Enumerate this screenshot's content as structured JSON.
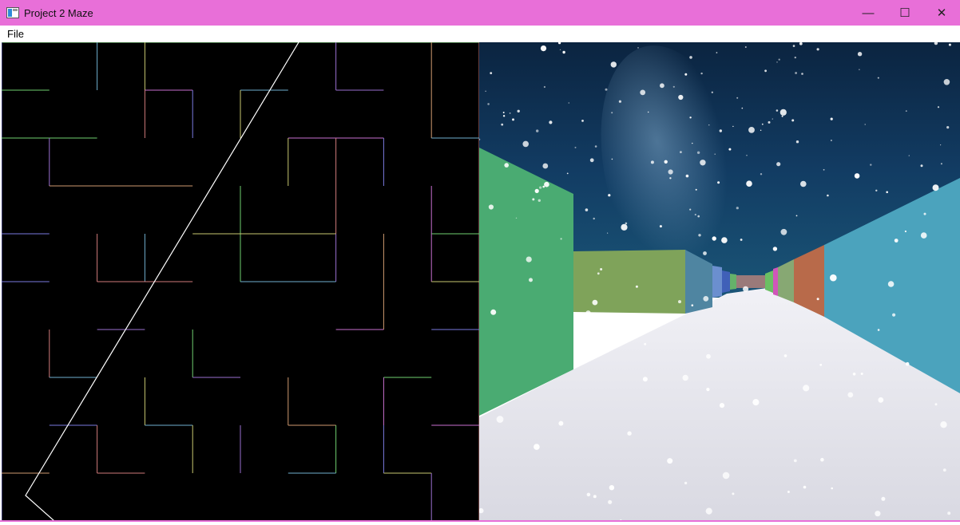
{
  "window": {
    "title": "Project 2 Maze",
    "minimize_glyph": "—",
    "maximize_glyph": "☐",
    "close_glyph": "✕",
    "titlebar_color": "#e86fd8"
  },
  "menu": {
    "items": [
      "File"
    ]
  },
  "maze": {
    "background": "#000000"
  },
  "view": {
    "sky_color": "#0e2c4f",
    "floor_color": "#e8e8ee"
  }
}
